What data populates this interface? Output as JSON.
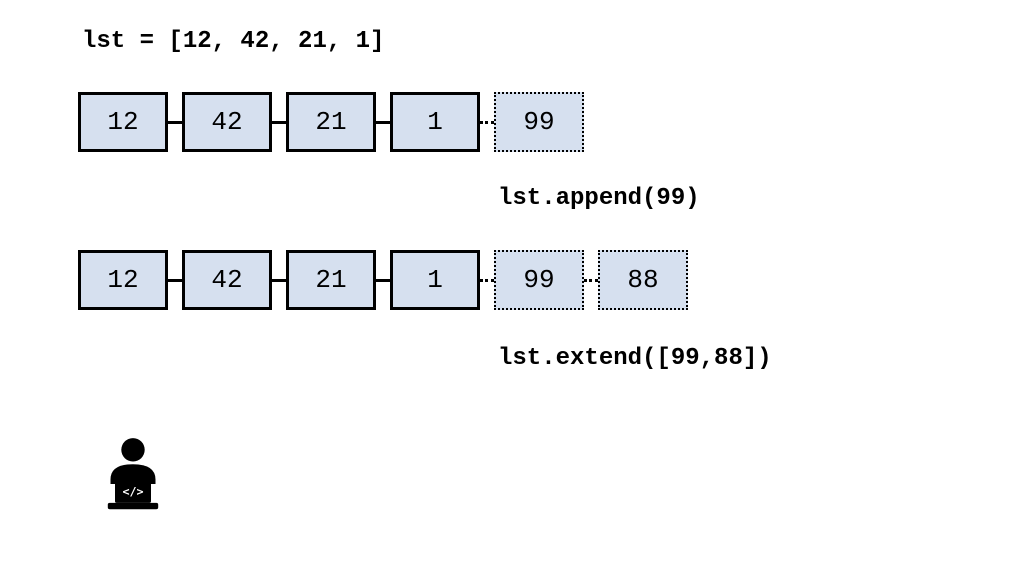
{
  "code": {
    "declaration": "lst = [12, 42, 21, 1]",
    "append_call": "lst.append(99)",
    "extend_call": "lst.extend([99,88])"
  },
  "list_initial": [
    "12",
    "42",
    "21",
    "1"
  ],
  "append_values": [
    "99"
  ],
  "extend_values": [
    "99",
    "88"
  ],
  "colors": {
    "box_fill": "#d6e0ef",
    "border": "#000000"
  }
}
